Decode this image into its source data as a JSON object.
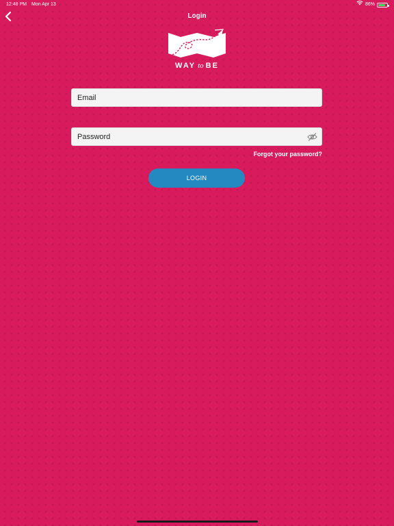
{
  "status_bar": {
    "time": "12:48 PM",
    "date": "Mon Apr 13",
    "battery_level": "86%",
    "battery_fill": 0.86,
    "wifi_icon": "wifi-icon",
    "battery_icon": "battery-icon"
  },
  "nav": {
    "title": "Login",
    "back_icon": "chevron-left-icon"
  },
  "logo": {
    "word1": "WAY",
    "word2": "to",
    "word3": "BE"
  },
  "form": {
    "email_placeholder": "Email",
    "email_value": "",
    "password_placeholder": "Password",
    "password_value": "",
    "eye_icon": "eye-slash-icon",
    "forgot_label": "Forgot your password?",
    "login_label": "LOGIN"
  },
  "colors": {
    "background": "#d81b5c",
    "button": "#2389c0",
    "field_bg": "#f4f4f4",
    "text": "#ffffff"
  }
}
